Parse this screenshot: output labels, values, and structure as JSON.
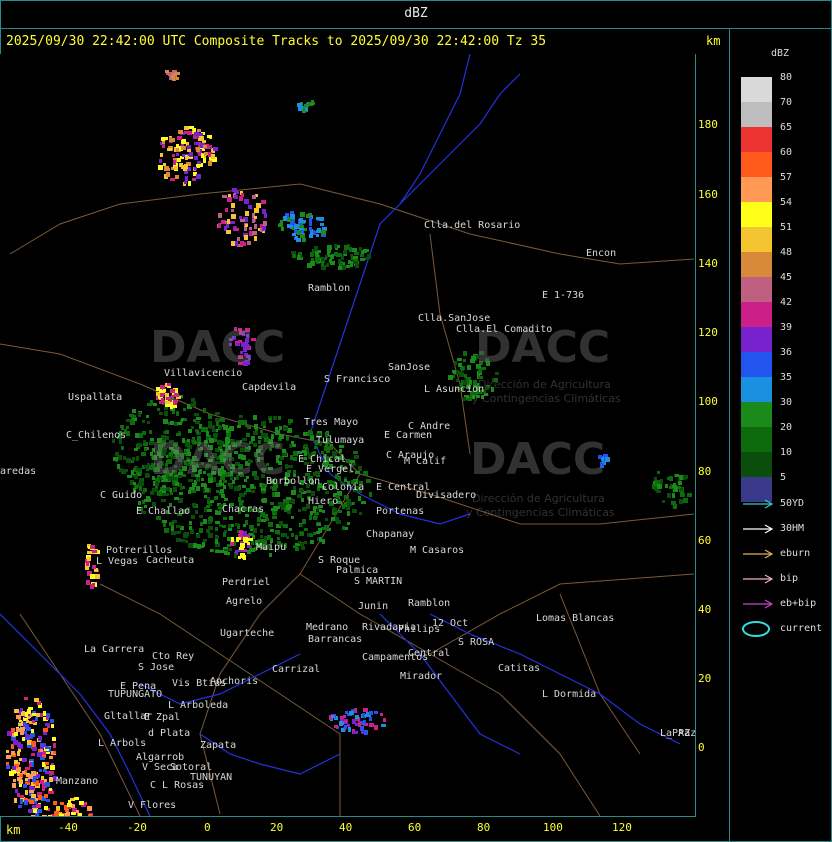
{
  "header": {
    "title": "dBZ",
    "subtitle": "2025/09/30 22:42:00 UTC Composite Tracks to 2025/09/30 22:42:00 Tz 35",
    "km_top": "km",
    "km_bottom": "km"
  },
  "axes": {
    "y_ticks": [
      "180",
      "160",
      "140",
      "120",
      "100",
      "80",
      "60",
      "40",
      "20",
      "0"
    ],
    "x_ticks": [
      "-40",
      "-20",
      "0",
      "20",
      "40",
      "60",
      "80",
      "100",
      "120"
    ]
  },
  "legend": {
    "title": "dBZ",
    "levels": [
      {
        "label": "80",
        "color": "#d9d9d9"
      },
      {
        "label": "70",
        "color": "#bdbdbd"
      },
      {
        "label": "65",
        "color": "#ee3333"
      },
      {
        "label": "60",
        "color": "#ff5a1a"
      },
      {
        "label": "57",
        "color": "#ff9955"
      },
      {
        "label": "54",
        "color": "#ffff1a"
      },
      {
        "label": "51",
        "color": "#f5c431"
      },
      {
        "label": "48",
        "color": "#d88a3a"
      },
      {
        "label": "45",
        "color": "#c06080"
      },
      {
        "label": "42",
        "color": "#cc1f88"
      },
      {
        "label": "39",
        "color": "#7722cc"
      },
      {
        "label": "36",
        "color": "#2255ee"
      },
      {
        "label": "35",
        "color": "#1b8fe0"
      },
      {
        "label": "30",
        "color": "#1a8a1a"
      },
      {
        "label": "20",
        "color": "#0d6b0d"
      },
      {
        "label": "10",
        "color": "#0b4d0b"
      },
      {
        "label": "5",
        "color": "#3a3a8a"
      }
    ],
    "tracks": [
      {
        "label": "50YD",
        "color": "#33cccc"
      },
      {
        "label": "30HM",
        "color": "#ffffff"
      },
      {
        "label": "eburn",
        "color": "#e0b060"
      },
      {
        "label": "bip",
        "color": "#f0b0c0"
      },
      {
        "label": "eb+bip",
        "color": "#cc44cc"
      },
      {
        "label": "current",
        "color": "#33dddd"
      }
    ]
  },
  "places": [
    "Clla.del Rosario",
    "Encon",
    "E 1-736",
    "Ramblon",
    "Clla.SanJose",
    "Clla.El Comadito",
    "Villavicencio",
    "Uspallata",
    "Capdevila",
    "S Francisco",
    "SanJose",
    "L Asuncion",
    "C_Chilenos",
    "Tres Mayo",
    "Tulumaya",
    "C Andre",
    "E Carmen",
    "E Chical",
    "C Araujo",
    "M Calif",
    "E Vergel",
    "Borbollon",
    "Colonia",
    "E Central",
    "Divisadero",
    "C Guido",
    "E Challao",
    "Chacras",
    "Hiero",
    "Portenas",
    "Potrerillos",
    "Cacheuta",
    "Maipu",
    "Chapanay",
    "M Casaros",
    "L Vegas",
    "Perdriel",
    "Agrelo",
    "S Roque",
    "Palmica",
    "S MARTIN",
    "Ugarteche",
    "Medrano",
    "Rivadavia",
    "Philips",
    "Ramblon",
    "12 Oct",
    "Lomas Blancas",
    "La Carrera",
    "Cto Rey",
    "S Jose",
    "Anchoris",
    "Barrancas",
    "Junin",
    "La Paz",
    "Carrizal",
    "Campamentos",
    "Central",
    "S ROSA",
    "Catitas",
    "E Pena",
    "TUPUNGATO",
    "Vis Btias",
    "Mirador",
    "L Dormida",
    "Gltallar",
    "E Zpal",
    "L Arboleda",
    "L Arbols",
    "d Plata",
    "Zapata",
    "Algarrob",
    "V Seca",
    "L_PAZ",
    "Manzano",
    "Sotoral",
    "TUNUYAN",
    "C L Rosas",
    "V Flores",
    "aredas"
  ],
  "watermark": {
    "name": "DACC",
    "line": "Dirección de Agricultura",
    "line2": "y Contingencias Climáticas"
  }
}
